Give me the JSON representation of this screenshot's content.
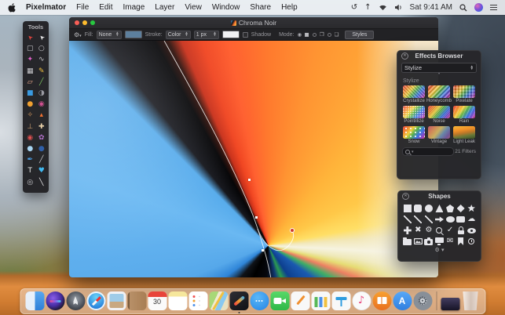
{
  "menu_bar": {
    "app_name": "Pixelmator",
    "items": [
      "File",
      "Edit",
      "Image",
      "Layer",
      "View",
      "Window",
      "Share",
      "Help"
    ],
    "time": "Sat 9:41 AM",
    "status_icons": [
      "time-machine",
      "up-arrow",
      "wifi",
      "volume",
      "spotlight",
      "siri",
      "notification-center"
    ]
  },
  "tools_panel": {
    "title": "Tools",
    "tools": [
      {
        "name": "move-tool",
        "glyph": "➤",
        "color": "#e0443e"
      },
      {
        "name": "pointer-tool",
        "glyph": "➤",
        "color": "#ececec"
      },
      {
        "name": "rectangular-selection-tool",
        "glyph": "▢",
        "color": "#c8c8cc"
      },
      {
        "name": "elliptical-selection-tool",
        "glyph": "○",
        "color": "#c8c8cc"
      },
      {
        "name": "magic-wand-tool",
        "glyph": "✦",
        "color": "#e060c8"
      },
      {
        "name": "lasso-tool",
        "glyph": "∿",
        "color": "#c8c8cc"
      },
      {
        "name": "crop-tool",
        "glyph": "▦",
        "color": "#c8c8cc"
      },
      {
        "name": "pencil-tool",
        "glyph": "✎",
        "color": "#f0c040"
      },
      {
        "name": "eraser-tool",
        "glyph": "▱",
        "color": "#e8a88a"
      },
      {
        "name": "paint-tool",
        "glyph": "╱",
        "color": "#7ac060"
      },
      {
        "name": "fill-tool",
        "glyph": "■",
        "color": "#3a9ae0"
      },
      {
        "name": "gradient-tool",
        "glyph": "◑",
        "color": "#9a9aa2"
      },
      {
        "name": "brush-tool",
        "glyph": "●",
        "color": "#f0a030"
      },
      {
        "name": "color-brush-tool",
        "glyph": "◉",
        "color": "#d05090"
      },
      {
        "name": "retouch-tool",
        "glyph": "✧",
        "color": "#e0a060"
      },
      {
        "name": "burn-tool",
        "glyph": "▴",
        "color": "#f07030"
      },
      {
        "name": "clone-stamp-tool",
        "glyph": "⊥",
        "color": "#d0a070"
      },
      {
        "name": "healing-tool",
        "glyph": "✚",
        "color": "#e8d0a8"
      },
      {
        "name": "red-eye-tool",
        "glyph": "◉",
        "color": "#e05050"
      },
      {
        "name": "sponge-tool",
        "glyph": "✿",
        "color": "#b070c8"
      },
      {
        "name": "blur-tool",
        "glyph": "●",
        "color": "#a8d4f0"
      },
      {
        "name": "sharpen-tool",
        "glyph": "●",
        "color": "#2f5fa8"
      },
      {
        "name": "pen-tool",
        "glyph": "✒",
        "color": "#4aa0e8"
      },
      {
        "name": "slice-tool",
        "glyph": "╱",
        "color": "#c8c8cc"
      },
      {
        "name": "type-tool",
        "glyph": "T",
        "color": "#ececec"
      },
      {
        "name": "shape-tool",
        "glyph": "♥",
        "color": "#40b8f0"
      },
      {
        "name": "zoom-tool",
        "glyph": "◎",
        "color": "#c8c8cc"
      },
      {
        "name": "eyedropper-tool",
        "glyph": "╲",
        "color": "#ececec"
      }
    ]
  },
  "document_window": {
    "title": "Chroma Noir",
    "toolbar": {
      "fill_label": "Fill:",
      "fill_value": "None",
      "stroke_label": "Stroke:",
      "stroke_value": "Color",
      "stroke_width": "1 px",
      "shadow_label": "Shadow",
      "mode_label": "Mode:",
      "styles_label": "Styles"
    }
  },
  "effects_browser": {
    "title": "Effects Browser",
    "category_value": "Stylize",
    "section_label": "Stylize",
    "effects": [
      {
        "label": "Crystallize",
        "slug": "crystallize"
      },
      {
        "label": "Honeycomb",
        "slug": "honeycomb"
      },
      {
        "label": "Pixelate",
        "slug": "pixelate"
      },
      {
        "label": "Pointillize",
        "slug": "pointillize"
      },
      {
        "label": "Noise",
        "slug": "noise"
      },
      {
        "label": "Rain",
        "slug": "rain"
      },
      {
        "label": "Snow",
        "slug": "snow"
      },
      {
        "label": "Vintage",
        "slug": "vintage"
      },
      {
        "label": "Light Leak",
        "slug": "light-leak"
      }
    ],
    "count_label": "21 Filters"
  },
  "shapes_panel": {
    "title": "Shapes",
    "shapes": [
      {
        "name": "square"
      },
      {
        "name": "rounded-square"
      },
      {
        "name": "circle"
      },
      {
        "name": "triangle"
      },
      {
        "name": "pentagon"
      },
      {
        "name": "diamond"
      },
      {
        "name": "star"
      },
      {
        "name": "line-1"
      },
      {
        "name": "line-2"
      },
      {
        "name": "line-3"
      },
      {
        "name": "arrow"
      },
      {
        "name": "speech-oval"
      },
      {
        "name": "speech-rect"
      },
      {
        "name": "cloud",
        "glyph": "☁"
      },
      {
        "name": "plus"
      },
      {
        "name": "multiply",
        "glyph": "✖"
      },
      {
        "name": "gear",
        "glyph": "⚙"
      },
      {
        "name": "magnifier"
      },
      {
        "name": "checkmark",
        "glyph": "✓"
      },
      {
        "name": "lock"
      },
      {
        "name": "eye"
      },
      {
        "name": "folder"
      },
      {
        "name": "picture"
      },
      {
        "name": "camera"
      },
      {
        "name": "display"
      },
      {
        "name": "envelope",
        "glyph": "✉"
      },
      {
        "name": "bookmark"
      },
      {
        "name": "clock"
      }
    ],
    "footer_gear": "⚙ ▾"
  },
  "dock": {
    "items": [
      {
        "name": "finder",
        "running": true
      },
      {
        "name": "siri"
      },
      {
        "name": "launchpad"
      },
      {
        "name": "safari"
      },
      {
        "name": "preview"
      },
      {
        "name": "contacts"
      },
      {
        "name": "calendar",
        "day": "30"
      },
      {
        "name": "notes"
      },
      {
        "name": "reminders"
      },
      {
        "name": "maps"
      },
      {
        "name": "pixelmator",
        "running": true
      },
      {
        "name": "messages"
      },
      {
        "name": "facetime"
      },
      {
        "name": "pages"
      },
      {
        "name": "numbers"
      },
      {
        "name": "keynote"
      },
      {
        "name": "itunes"
      },
      {
        "name": "ibooks"
      },
      {
        "name": "appstore"
      },
      {
        "name": "system-preferences"
      },
      {
        "separator": true
      },
      {
        "name": "minimized-window"
      },
      {
        "name": "trash"
      }
    ]
  },
  "colors": {
    "panel_bg": "#262629",
    "menubar_bg": "#f2f5f7",
    "window_chrome": "#2a2a2d",
    "accent_blue": "#2f7fd8"
  }
}
